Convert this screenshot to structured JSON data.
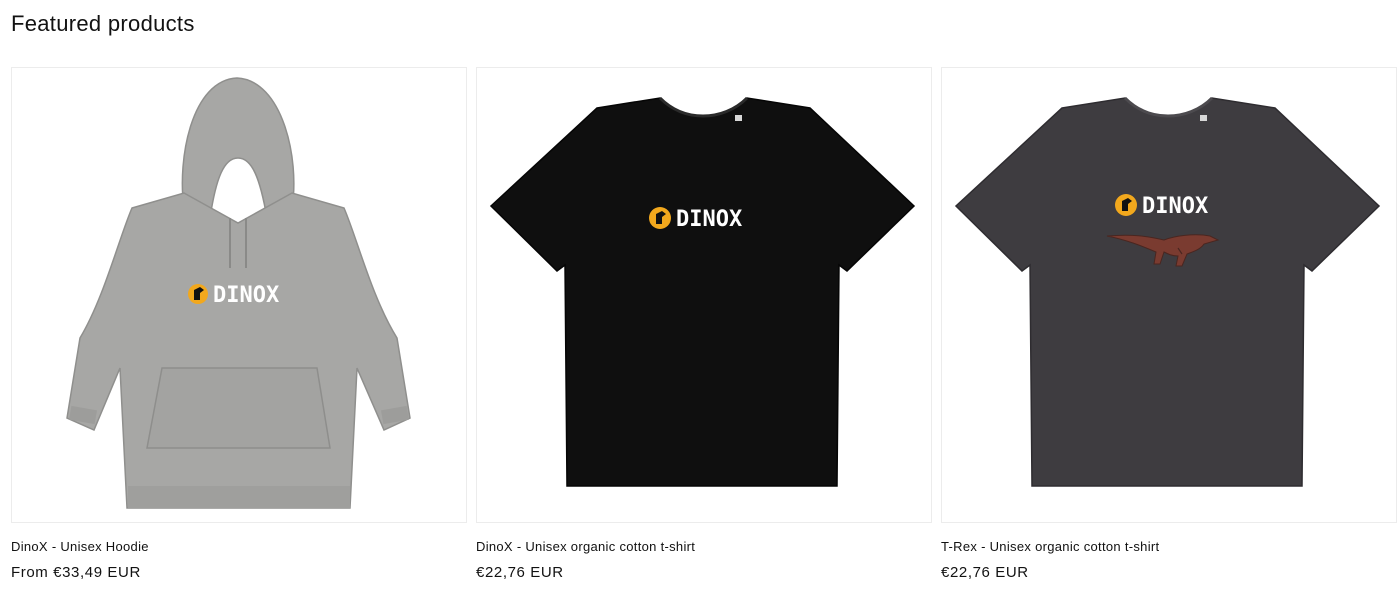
{
  "section": {
    "title": "Featured products"
  },
  "products": [
    {
      "title": "DinoX - Unisex Hoodie",
      "price": "From €33,49 EUR",
      "logo_text": "DINOX",
      "garment": "hoodie-icon",
      "color": "#a7a7a5"
    },
    {
      "title": "DinoX - Unisex organic cotton t-shirt",
      "price": "€22,76 EUR",
      "logo_text": "DINOX",
      "garment": "tshirt-icon",
      "color": "#0f0f0f"
    },
    {
      "title": "T-Rex - Unisex organic cotton t-shirt",
      "price": "€22,76 EUR",
      "logo_text": "DINOX",
      "garment": "tshirt-icon",
      "color": "#3e3c40"
    }
  ],
  "colors": {
    "logo_badge": "#f2a81d",
    "logo_text": "#ffffff",
    "border": "#ececec",
    "dino_print": "#7a3b30"
  }
}
